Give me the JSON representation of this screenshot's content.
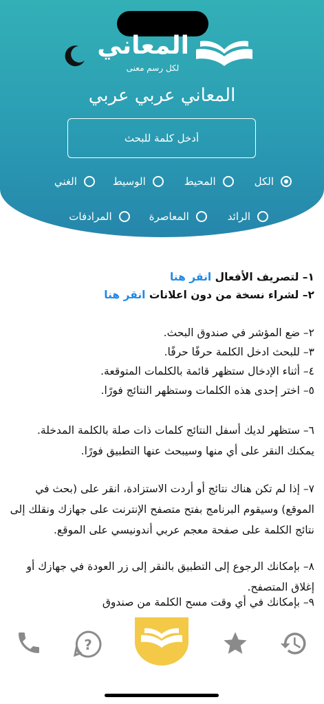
{
  "logo": {
    "name": "المعاني",
    "tagline": "لكل رسم معنى"
  },
  "page_title": "المعاني عربي عربي",
  "search": {
    "placeholder": "أدخل كلمة للبحث"
  },
  "dictionaries": {
    "row1": [
      {
        "label": "الكل",
        "selected": true
      },
      {
        "label": "المحيط",
        "selected": false
      },
      {
        "label": "الوسيط",
        "selected": false
      },
      {
        "label": "الغني",
        "selected": false
      }
    ],
    "row2": [
      {
        "label": "الرائد",
        "selected": false
      },
      {
        "label": "المعاصرة",
        "selected": false
      },
      {
        "label": "المرادفات",
        "selected": false
      }
    ]
  },
  "links": {
    "conjugation_text": "١– لتصريف الأفعال",
    "conjugation_link": "انقر هنا",
    "purchase_text": "٢– لشراء نسخة من دون اعلانات",
    "purchase_link": "انقر هنا"
  },
  "instructions": {
    "step2": "٢– ضع المؤشر في صندوق البحث.",
    "step3": "٣– للبحث ادخل الكلمة حرفًا حرفًا.",
    "step4": "٤– أثناء الإدخال ستظهر قائمة بالكلمات المتوقعة.",
    "step5": "٥– اختر إحدى هذه الكلمات وستظهر النتائج فورًا.",
    "step6": "٦– ستظهر لديك أسفل النتائج كلمات ذات صلة بالكلمة المدخلة. يمكنك النقر على أي منها وسيبحث عنها التطبيق فورًا.",
    "step7": "٧– إذا لم تكن هناك نتائج أو أردت الاستزادة، انقر على (بحث في الموقع) وسيقوم البرنامج بفتح متصفح الإنترنت على جهازك ونقلك إلى نتائج الكلمة على صفحة معجم عربي أندونيسي على الموقع.",
    "step8": "٨– بإمكانك الرجوع إلى التطبيق بالنقر إلى زر العودة في جهازك أو إغلاق المتصفح.",
    "step9": "٩– بإمكانك في أي وقت مسح الكلمة من صندوق"
  },
  "colors": {
    "accent": "#2a9cb3",
    "link": "#1e88e5",
    "nav_icon": "#8a8a8a",
    "home_badge": "#f3c947"
  },
  "nav": [
    "phone-icon",
    "help-icon",
    "home-book-icon",
    "star-icon",
    "history-icon"
  ]
}
